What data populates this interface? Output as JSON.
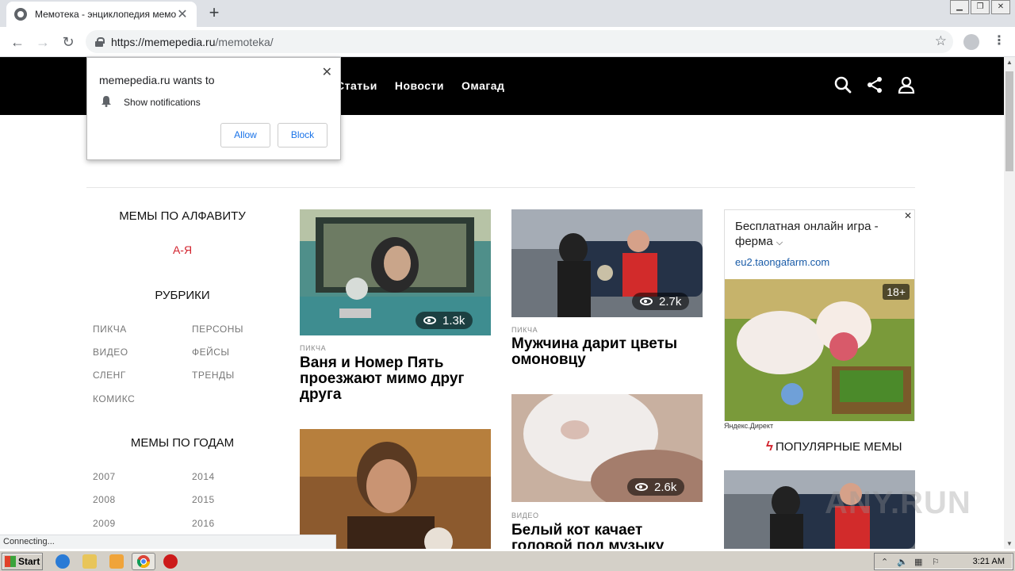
{
  "browser": {
    "tab_title": "Мемотека - энциклопедия мемов",
    "url_host": "https://memepedia.ru",
    "url_path": "/memoteka/",
    "status_text": "Connecting..."
  },
  "notification": {
    "title": "memepedia.ru wants to",
    "text": "Show notifications",
    "allow_label": "Allow",
    "block_label": "Block"
  },
  "site_nav": [
    "Статьи",
    "Новости",
    "Омагад"
  ],
  "sidebar": {
    "alphabet_heading": "МЕМЫ ПО АЛФАВИТУ",
    "alphabet_link": "А-Я",
    "rubrics_heading": "РУБРИКИ",
    "rubrics": [
      "ПИКЧА",
      "ПЕРСОНЫ",
      "ВИДЕО",
      "ФЕЙСЫ",
      "СЛЕНГ",
      "ТРЕНДЫ",
      "КОМИКС"
    ],
    "years_heading": "МЕМЫ ПО ГОДАМ",
    "years": [
      "2007",
      "2014",
      "2008",
      "2015",
      "2009",
      "2016"
    ]
  },
  "cards": [
    {
      "views": "1.3k",
      "category": "ПИКЧА",
      "title": "Ваня и Номер Пять проезжают мимо друг друга"
    },
    {
      "views": "2.7k",
      "category": "ПИКЧА",
      "title": "Мужчина дарит цветы омоновцу"
    },
    {
      "views": "2.6k",
      "category": "ВИДЕО",
      "title": "Белый кот качает головой под музыку"
    }
  ],
  "ad": {
    "title": "Бесплатная онлайн игра - ферма",
    "domain": "eu2.taongafarm.com",
    "age": "18+",
    "footer": "Яндекс.Директ"
  },
  "popular_heading": "ПОПУЛЯРНЫЕ МЕМЫ",
  "watermark": "ANY.RUN",
  "taskbar": {
    "start_label": "Start",
    "clock": "3:21 AM"
  },
  "colors": {
    "accent": "#d2222d",
    "header_bg": "#000000",
    "link_blue": "#1a73e8"
  }
}
